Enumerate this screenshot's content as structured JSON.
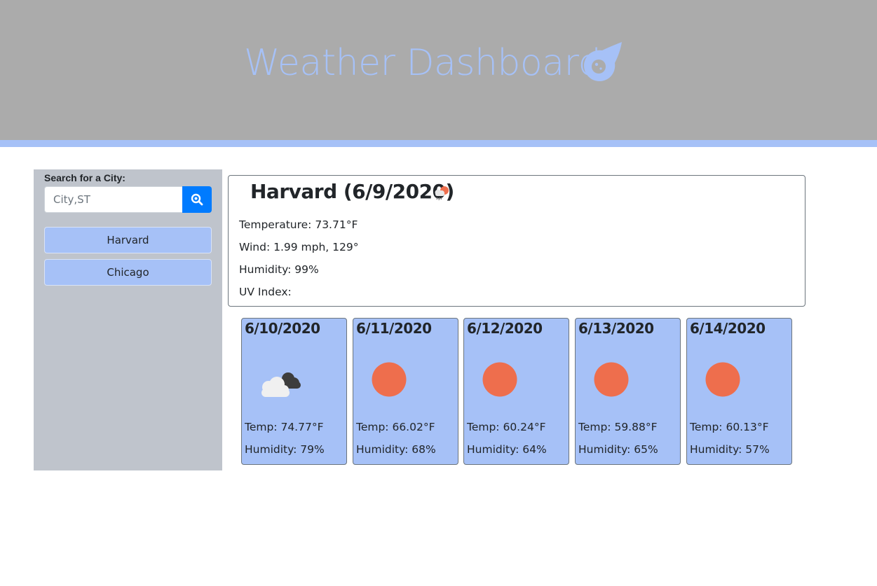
{
  "header": {
    "title": "Weather Dashboard",
    "icon": "meteor-icon"
  },
  "sidebar": {
    "search_label": "Search for a City:",
    "search_placeholder": "City,ST",
    "search_icon": "search-icon",
    "cities": [
      {
        "label": "Harvard"
      },
      {
        "label": "Chicago"
      }
    ]
  },
  "current": {
    "title": "Harvard (6/9/2020)",
    "icon": "rain-sun-icon",
    "temperature": "Temperature: 73.71°F",
    "wind": "Wind: 1.99 mph, 129°",
    "humidity": "Humidity: 99%",
    "uv_index": "UV Index:"
  },
  "forecast": [
    {
      "date": "6/10/2020",
      "icon": "clouds-icon",
      "temp": "Temp: 74.77°F",
      "humidity": "Humidity: 79%"
    },
    {
      "date": "6/11/2020",
      "icon": "sun-icon",
      "temp": "Temp: 66.02°F",
      "humidity": "Humidity: 68%"
    },
    {
      "date": "6/12/2020",
      "icon": "sun-icon",
      "temp": "Temp: 60.24°F",
      "humidity": "Humidity: 64%"
    },
    {
      "date": "6/13/2020",
      "icon": "sun-icon",
      "temp": "Temp: 59.88°F",
      "humidity": "Humidity: 65%"
    },
    {
      "date": "6/14/2020",
      "icon": "sun-icon",
      "temp": "Temp: 60.13°F",
      "humidity": "Humidity: 57%"
    }
  ],
  "colors": {
    "header_bg": "#ababab",
    "accent": "#a6c1f7",
    "sidebar_bg": "#bfc4cc",
    "search_button": "#007bff",
    "sun": "#ee6e4d"
  }
}
